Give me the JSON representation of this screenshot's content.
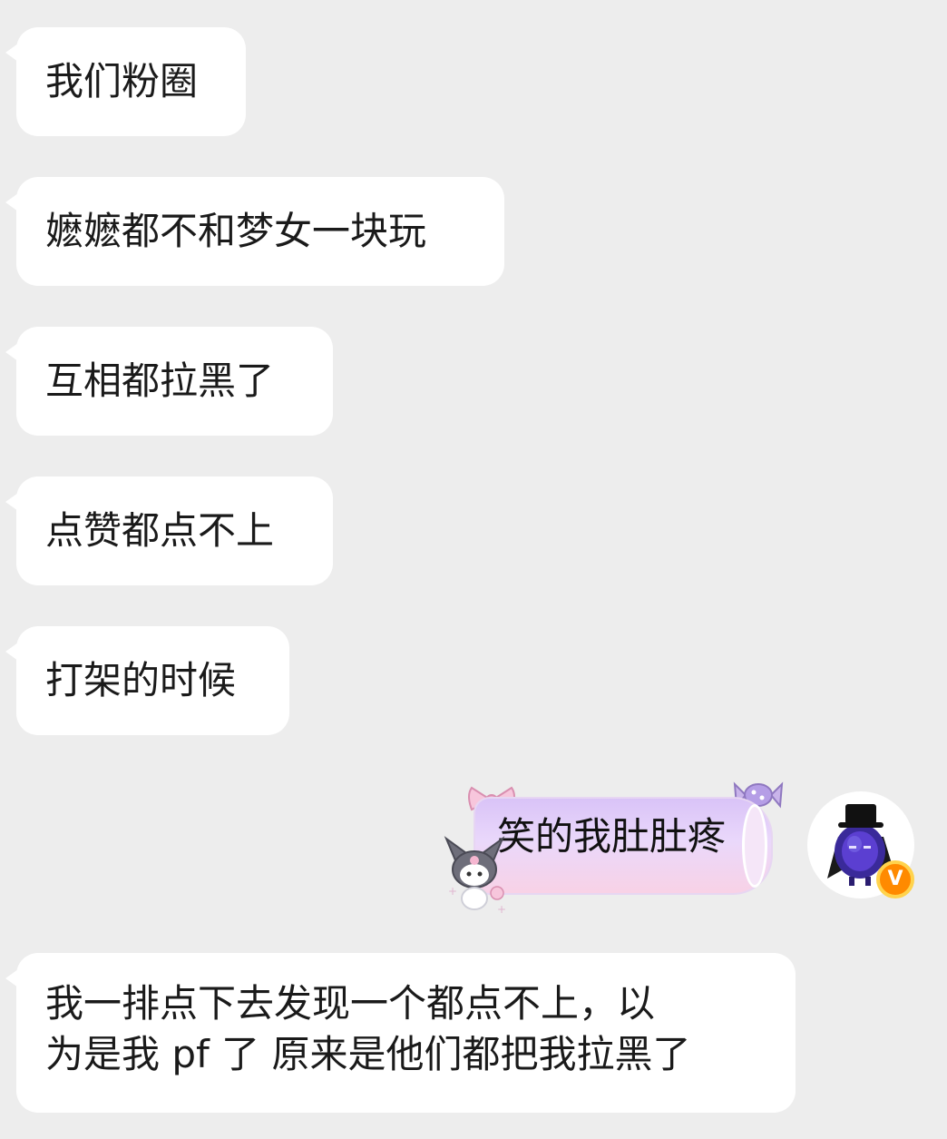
{
  "chat": {
    "messages": [
      {
        "text": "我们粉圈"
      },
      {
        "text": "嬷嬷都不和梦女一块玩"
      },
      {
        "text": "互相都拉黑了"
      },
      {
        "text": "点赞都点不上"
      },
      {
        "text": "打架的时候"
      }
    ],
    "sticker_text": "笑的我肚肚疼",
    "last_message": {
      "line1": "我一排点下去发现一个都点不上，以",
      "line2": "为是我 pf 了 原来是他们都把我拉黑了"
    },
    "badge_text": "V"
  },
  "colors": {
    "background": "#ededed",
    "bubble": "#ffffff",
    "badge": "#ff8a00"
  }
}
